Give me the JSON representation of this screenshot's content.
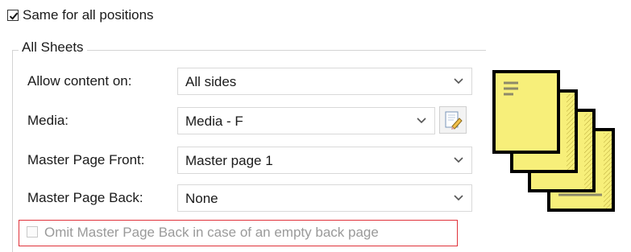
{
  "same_for_all": {
    "label": "Same for all positions",
    "checked": true
  },
  "group": {
    "title": "All Sheets",
    "rows": [
      {
        "label": "Allow content on:",
        "value": "All sides"
      },
      {
        "label": "Media:",
        "value": "Media - F"
      },
      {
        "label": "Master Page Front:",
        "value": "Master page 1"
      },
      {
        "label": "Master Page Back:",
        "value": "None"
      }
    ]
  },
  "omit_back": {
    "label": "Omit Master Page Back in case of an empty back page",
    "checked": false,
    "enabled": false
  },
  "icons": {
    "chevron": "chevron-down-icon",
    "edit_media": "edit-media-icon",
    "sheets_illustration": "stacked-sheets-icon"
  },
  "colors": {
    "highlight_border": "#e0323a",
    "sheet_fill": "#f7ef7a"
  }
}
